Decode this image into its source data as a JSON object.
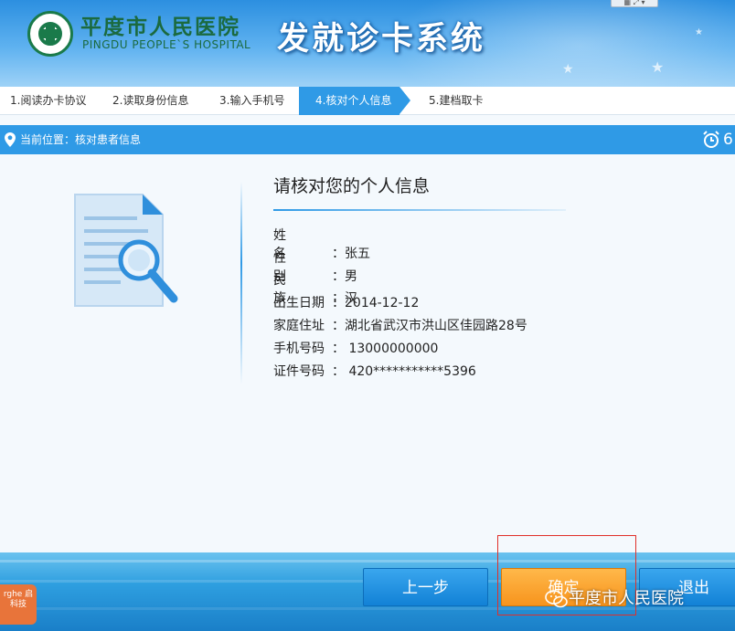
{
  "header": {
    "hospital_name_cn": "平度市人民医院",
    "hospital_name_en": "PINGDU PEOPLE`S HOSPITAL",
    "system_title": "发就诊卡系统",
    "logo_icon": "hospital-logo-icon"
  },
  "steps": [
    {
      "label": "1.阅读办卡协议",
      "active": false
    },
    {
      "label": "2.读取身份信息",
      "active": false
    },
    {
      "label": "3.输入手机号",
      "active": false
    },
    {
      "label": "4.核对个人信息",
      "active": true
    },
    {
      "label": "5.建档取卡",
      "active": false
    }
  ],
  "location": {
    "text": "当前位置：核对患者信息",
    "countdown": "6"
  },
  "main": {
    "heading": "请核对您的个人信息",
    "fields": [
      {
        "label": "姓名",
        "value": "张五"
      },
      {
        "label": "性别",
        "value": "男"
      },
      {
        "label": "民族",
        "value": "汉"
      },
      {
        "label": "出生日期",
        "value": "2014-12-12"
      },
      {
        "label": "家庭住址",
        "value": "湖北省武汉市洪山区佳园路28号"
      },
      {
        "label": "手机号码",
        "value": " 13000000000"
      },
      {
        "label": "证件号码",
        "value": " 420***********5396"
      }
    ]
  },
  "footer": {
    "prev_label": "上一步",
    "ok_label": "确定",
    "exit_label": "退出",
    "watermark": "平度市人民医院",
    "badge_text": "rghe 启科技"
  },
  "colors": {
    "accent_blue": "#2f9ae6",
    "confirm_orange": "#f7941d",
    "logo_green": "#1a7a4a"
  }
}
